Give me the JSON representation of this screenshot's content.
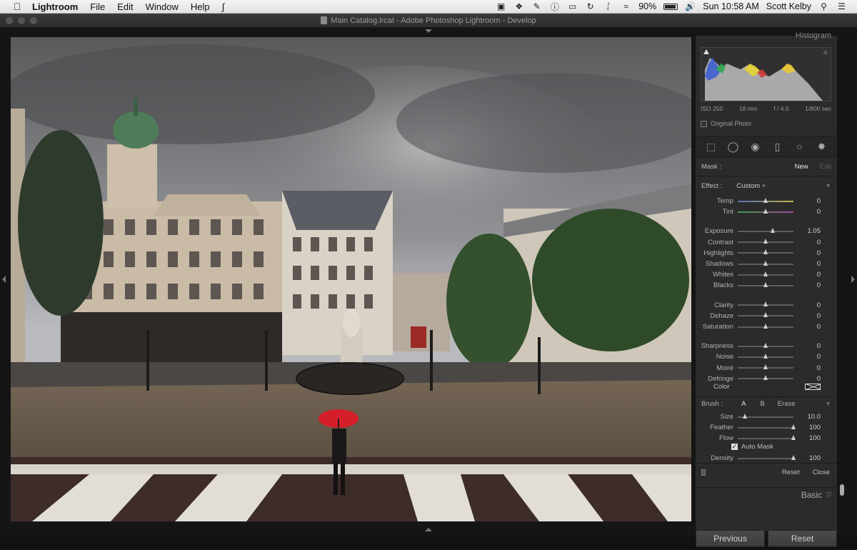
{
  "menubar": {
    "app": "Lightroom",
    "items": [
      "File",
      "Edit",
      "Window",
      "Help"
    ],
    "battery": "90%",
    "clock": "Sun 10:58 AM",
    "user": "Scott Kelby",
    "battery_level": 0.9
  },
  "window": {
    "title": "Main Catalog.lrcat - Adobe Photoshop Lightroom - Develop"
  },
  "histogram": {
    "header": "Histogram",
    "iso": "ISO 250",
    "focal": "18 mm",
    "aperture": "f / 4.0",
    "shutter": "1/800 sec",
    "original_photo": "Original Photo"
  },
  "mask": {
    "label": "Mask :",
    "new": "New",
    "edit": "Edit"
  },
  "effect": {
    "label": "Effect :",
    "preset": "Custom ÷"
  },
  "sliders": [
    {
      "label": "Temp",
      "value": "0",
      "pos": 0.5,
      "kind": "temp"
    },
    {
      "label": "Tint",
      "value": "0",
      "pos": 0.5,
      "kind": "tint"
    },
    {
      "label": "Exposure",
      "value": "1.05",
      "pos": 0.63,
      "kind": "plain"
    },
    {
      "label": "Contrast",
      "value": "0",
      "pos": 0.5,
      "kind": "plain"
    },
    {
      "label": "Highlights",
      "value": "0",
      "pos": 0.5,
      "kind": "plain"
    },
    {
      "label": "Shadows",
      "value": "0",
      "pos": 0.5,
      "kind": "plain"
    },
    {
      "label": "Whites",
      "value": "0",
      "pos": 0.5,
      "kind": "plain"
    },
    {
      "label": "Blacks",
      "value": "0",
      "pos": 0.5,
      "kind": "plain"
    },
    {
      "label": "Clarity",
      "value": "0",
      "pos": 0.5,
      "kind": "plain"
    },
    {
      "label": "Dehaze",
      "value": "0",
      "pos": 0.5,
      "kind": "plain"
    },
    {
      "label": "Saturation",
      "value": "0",
      "pos": 0.5,
      "kind": "plain"
    },
    {
      "label": "Sharpness",
      "value": "0",
      "pos": 0.5,
      "kind": "plain"
    },
    {
      "label": "Noise",
      "value": "0",
      "pos": 0.5,
      "kind": "plain"
    },
    {
      "label": "Moiré",
      "value": "0",
      "pos": 0.5,
      "kind": "plain"
    },
    {
      "label": "Defringe",
      "value": "0",
      "pos": 0.5,
      "kind": "plain"
    }
  ],
  "color": {
    "label": "Color"
  },
  "brush": {
    "label": "Brush :",
    "a": "A",
    "b": "B",
    "erase": "Erase",
    "sliders": [
      {
        "label": "Size",
        "value": "10.0",
        "pos": 0.13
      },
      {
        "label": "Feather",
        "value": "100",
        "pos": 1.0
      },
      {
        "label": "Flow",
        "value": "100",
        "pos": 1.0
      }
    ],
    "auto_mask": "Auto Mask",
    "density": {
      "label": "Density",
      "value": "100",
      "pos": 1.0
    }
  },
  "panel_bottom": {
    "reset": "Reset",
    "close": "Close",
    "basic": "Basic"
  },
  "buttons": {
    "previous": "Previous",
    "reset": "Reset"
  }
}
